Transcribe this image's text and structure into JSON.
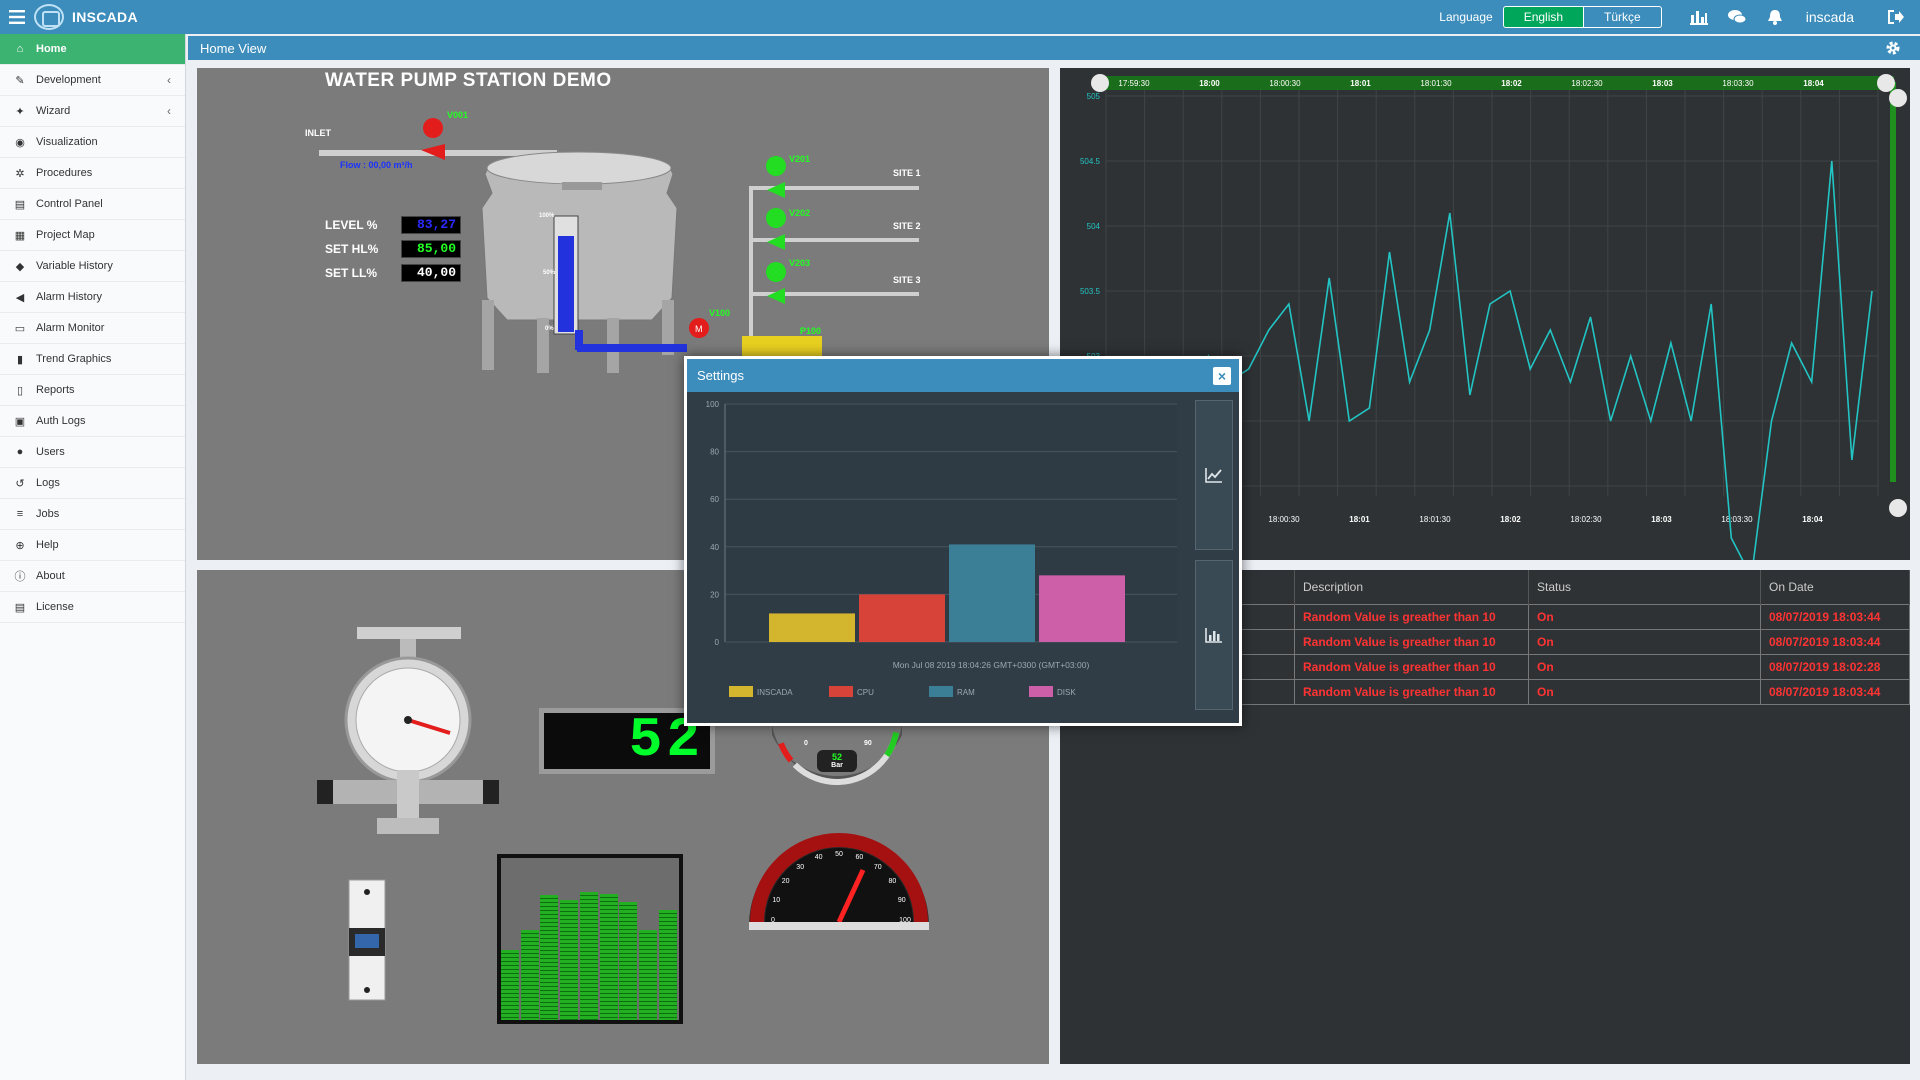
{
  "app": {
    "title": "INSCADA",
    "language_label": "Language",
    "lang_english": "English",
    "lang_turkish": "Türkçe",
    "user": "inscada"
  },
  "sidebar": {
    "items": [
      {
        "label": "Home",
        "icon": "home-icon",
        "active": true
      },
      {
        "label": "Development",
        "icon": "wrench-icon",
        "arrow": true
      },
      {
        "label": "Wizard",
        "icon": "magic-icon",
        "arrow": true
      },
      {
        "label": "Visualization",
        "icon": "eye-icon"
      },
      {
        "label": "Procedures",
        "icon": "cog-icon"
      },
      {
        "label": "Control Panel",
        "icon": "panel-icon"
      },
      {
        "label": "Project Map",
        "icon": "map-icon"
      },
      {
        "label": "Variable History",
        "icon": "tag-icon"
      },
      {
        "label": "Alarm History",
        "icon": "bullhorn-icon"
      },
      {
        "label": "Alarm Monitor",
        "icon": "monitor-icon"
      },
      {
        "label": "Trend Graphics",
        "icon": "bar-chart-icon"
      },
      {
        "label": "Reports",
        "icon": "file-icon"
      },
      {
        "label": "Auth Logs",
        "icon": "id-card-icon"
      },
      {
        "label": "Users",
        "icon": "user-icon"
      },
      {
        "label": "Logs",
        "icon": "history-icon"
      },
      {
        "label": "Jobs",
        "icon": "list-icon"
      },
      {
        "label": "Help",
        "icon": "lifebuoy-icon"
      },
      {
        "label": "About",
        "icon": "info-icon"
      },
      {
        "label": "License",
        "icon": "license-icon"
      }
    ]
  },
  "content": {
    "header": "Home View"
  },
  "scada": {
    "title": "WATER PUMP STATION DEMO",
    "inlet": "INLET",
    "flow": "Flow : 00,00 m³/h",
    "level_label": "LEVEL %",
    "level_value": "83,27",
    "sethl_label": "SET HL%",
    "sethl_value": "85,00",
    "setll_label": "SET LL%",
    "setll_value": "40,00",
    "valve_inlet": "V001",
    "valve_v100": "V100",
    "pump": "P100",
    "valves": [
      "V201",
      "V202",
      "V203"
    ],
    "sites": [
      "SITE 1",
      "SITE 2",
      "SITE 3"
    ],
    "tank_scale": [
      "100%",
      "50%",
      "0%"
    ],
    "digital_display": "52",
    "gauge_small_value": "52",
    "gauge_small_unit": "Bar",
    "gauge_small_ticks": [
      "0",
      "90"
    ],
    "gauge_big_ticks": [
      "0",
      "10",
      "20",
      "30",
      "40",
      "50",
      "60",
      "70",
      "80",
      "90",
      "100"
    ]
  },
  "trend": {
    "top_labels": [
      "17:59:30",
      "18:00",
      "18:00:30",
      "18:01",
      "18:01:30",
      "18:02",
      "18:02:30",
      "18:03",
      "18:03:30",
      "18:04"
    ],
    "bottom_labels": [
      "18:00:30",
      "18:01",
      "18:01:30",
      "18:02",
      "18:02:30",
      "18:03",
      "18:03:30",
      "18:04"
    ],
    "y_labels": [
      "505",
      "504.5",
      "504",
      "503.5",
      "503",
      "502.5",
      "502"
    ],
    "values": [
      503,
      502.6,
      502.3,
      502.5,
      502.2,
      503,
      502.8,
      502.9,
      503.2,
      503.4,
      502.5,
      503.6,
      502.5,
      502.6,
      503.8,
      502.8,
      503.2,
      504.1,
      502.7,
      503.4,
      503.5,
      502.9,
      503.2,
      502.8,
      503.3,
      502.5,
      503,
      502.5,
      503.1,
      502.5,
      503.4,
      501.6,
      501.3,
      502.5,
      503.1,
      502.8,
      504.5,
      502.2,
      503.5
    ]
  },
  "alarms": {
    "columns": [
      "",
      "Description",
      "Status",
      "On Date"
    ],
    "rows": [
      {
        "description": "Random Value is greather than 10",
        "status": "On",
        "date": "08/07/2019 18:03:44"
      },
      {
        "description": "Random Value is greather than 10",
        "status": "On",
        "date": "08/07/2019 18:03:44"
      },
      {
        "description": "Random Value is greather than 10",
        "status": "On",
        "date": "08/07/2019 18:02:28"
      },
      {
        "description": "Random Value is greather than 10",
        "status": "On",
        "date": "08/07/2019 18:03:44"
      }
    ]
  },
  "modal": {
    "title": "Settings",
    "close": "×"
  },
  "colors": {
    "primary": "#3c8dbc",
    "active": "#3cb371",
    "alarm": "#ff3333",
    "trend_line": "#22c4c4"
  },
  "chart_data": {
    "type": "bar",
    "categories": [
      "INSCADA",
      "CPU",
      "RAM",
      "DISK"
    ],
    "values": [
      12,
      20,
      41,
      28
    ],
    "colors": [
      "#d4b52e",
      "#d84339",
      "#3a7f96",
      "#cc5fa8"
    ],
    "ylim": [
      0,
      100
    ],
    "yticks": [
      0,
      20,
      40,
      60,
      80,
      100
    ],
    "xlabel": "Mon Jul 08 2019 18:04:26 GMT+0300 (GMT+03:00)",
    "legend_placement": "bottom",
    "grid": true
  }
}
